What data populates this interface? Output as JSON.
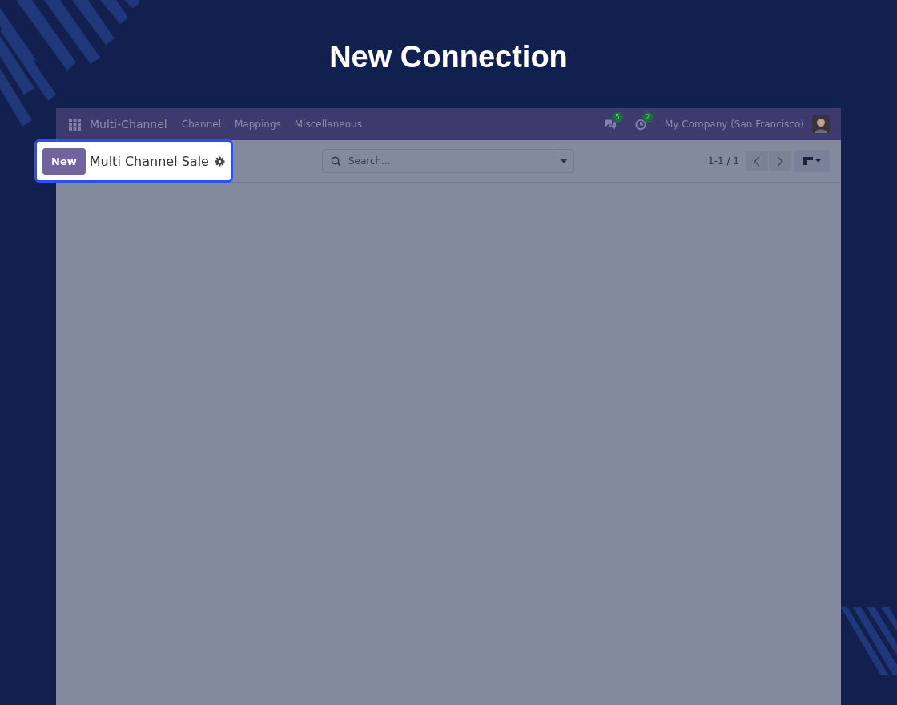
{
  "heading": "New Connection",
  "navbar": {
    "app_name": "Multi-Channel",
    "menu": [
      "Channel",
      "Mappings",
      "Miscellaneous"
    ],
    "messages_badge": "5",
    "activities_badge": "2",
    "company": "My Company (San Francisco)"
  },
  "control_panel": {
    "new_button": "New",
    "breadcrumb": "Multi Channel Sale",
    "search": {
      "placeholder": "Search..."
    },
    "pager": "1-1 / 1"
  }
}
